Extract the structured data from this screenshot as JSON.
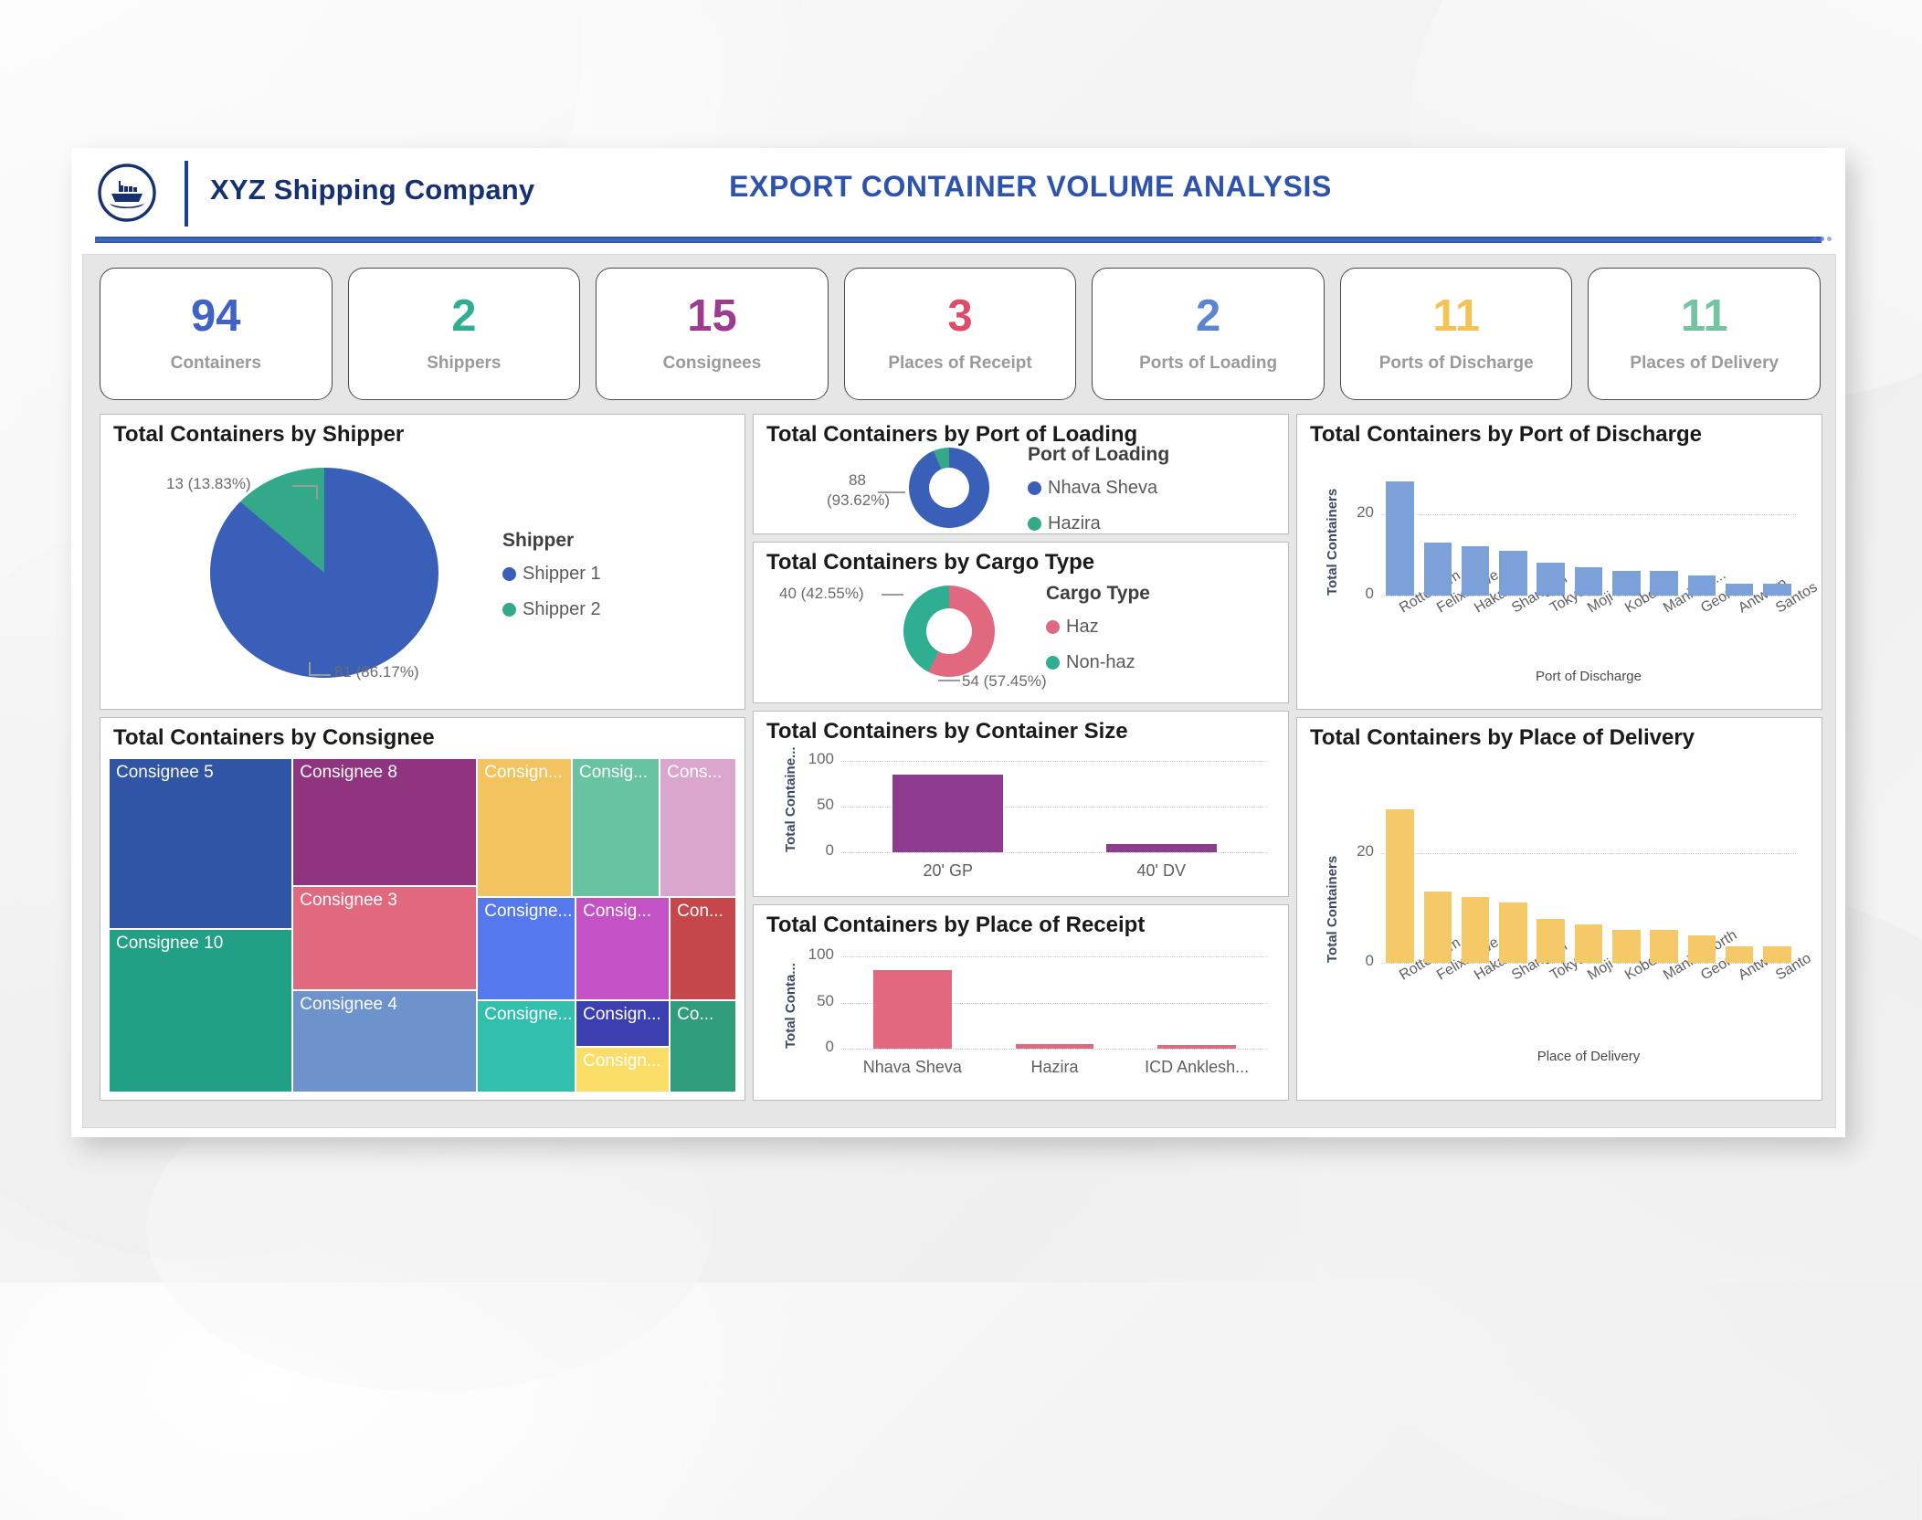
{
  "header": {
    "logo_icon": "ship-icon",
    "company_name": "XYZ Shipping Company",
    "dashboard_title": "EXPORT CONTAINER VOLUME ANALYSIS",
    "brand_color": "#2d53ad"
  },
  "kpis": [
    {
      "value": "94",
      "label": "Containers",
      "color": "#3f62c4"
    },
    {
      "value": "2",
      "label": "Shippers",
      "color": "#2fae92"
    },
    {
      "value": "15",
      "label": "Consignees",
      "color": "#9c3c8f"
    },
    {
      "value": "3",
      "label": "Places of Receipt",
      "color": "#dd4d6a"
    },
    {
      "value": "2",
      "label": "Ports of Loading",
      "color": "#5b86cf"
    },
    {
      "value": "11",
      "label": "Ports of Discharge",
      "color": "#f5c255"
    },
    {
      "value": "11",
      "label": "Places of Delivery",
      "color": "#74c4a2"
    }
  ],
  "panels": {
    "shipper": {
      "title": "Total Containers by Shipper"
    },
    "consignee": {
      "title": "Total Containers by Consignee"
    },
    "pol": {
      "title": "Total Containers by Port of Loading"
    },
    "cargo": {
      "title": "Total Containers by Cargo Type"
    },
    "size": {
      "title": "Total Containers by Container Size"
    },
    "receipt": {
      "title": "Total Containers by Place of Receipt"
    },
    "pod": {
      "title": "Total Containers by Port of Discharge"
    },
    "delivery": {
      "title": "Total Containers by Place of Delivery"
    }
  },
  "chart_data": [
    {
      "id": "shipper_pie",
      "type": "pie",
      "title": "Total Containers by Shipper",
      "legend_title": "Shipper",
      "legend_position": "right",
      "categories": [
        "Shipper 1",
        "Shipper 2"
      ],
      "values": [
        81,
        13
      ],
      "percents": [
        "86.17%",
        "13.83%"
      ],
      "data_labels": [
        "81 (86.17%)",
        "13 (13.83%)"
      ],
      "colors": [
        "#3a5fb8",
        "#34a98a"
      ]
    },
    {
      "id": "consignee_treemap",
      "type": "treemap",
      "title": "Total Containers by Consignee",
      "categories": [
        "Consignee 5",
        "Consignee 10",
        "Consignee 8",
        "Consignee 3",
        "Consignee 4",
        "Consign...",
        "Consig...",
        "Cons...",
        "Consigne...",
        "Consig...",
        "Con...",
        "Consigne...",
        "Consign...",
        "Consign...",
        "Co..."
      ],
      "colors": [
        "#2f55a4",
        "#22a085",
        "#913480",
        "#e0697f",
        "#6e93cc",
        "#f2c35e",
        "#68c3a3",
        "#dba6ce",
        "#5578ef",
        "#c452c6",
        "#c5474a",
        "#33bfae",
        "#3c3fb0",
        "#fade68",
        "#2f9d79"
      ]
    },
    {
      "id": "pol_donut",
      "type": "pie",
      "title": "Total Containers by Port of Loading",
      "legend_title": "Port of Loading",
      "legend_position": "right",
      "categories": [
        "Nhava Sheva",
        "Hazira"
      ],
      "values": [
        88,
        6
      ],
      "percents": [
        "93.62%",
        "6.38%"
      ],
      "data_labels": [
        "88",
        "(93.62%)"
      ],
      "colors": [
        "#3a5fb8",
        "#34a98a"
      ]
    },
    {
      "id": "cargo_donut",
      "type": "pie",
      "title": "Total Containers by Cargo Type",
      "legend_title": "Cargo Type",
      "legend_position": "right",
      "categories": [
        "Haz",
        "Non-haz"
      ],
      "values": [
        54,
        40
      ],
      "percents": [
        "57.45%",
        "42.55%"
      ],
      "data_labels": [
        "54 (57.45%)",
        "40 (42.55%)"
      ],
      "colors": [
        "#e0697f",
        "#2fae92"
      ]
    },
    {
      "id": "container_size_bar",
      "type": "bar",
      "title": "Total Containers by Container Size",
      "ylabel": "Total Containe...",
      "xlabel": "",
      "categories": [
        "20' GP",
        "40' DV"
      ],
      "values": [
        85,
        9
      ],
      "yticks": [
        0,
        50,
        100
      ],
      "ylim": [
        0,
        100
      ],
      "color": "#8c3b8e",
      "grid": true
    },
    {
      "id": "place_of_receipt_bar",
      "type": "bar",
      "title": "Total Containers by Place of Receipt",
      "ylabel": "Total Conta...",
      "xlabel": "",
      "categories": [
        "Nhava Sheva",
        "Hazira",
        "ICD Anklesh..."
      ],
      "values": [
        85,
        5,
        4
      ],
      "yticks": [
        0,
        50,
        100
      ],
      "ylim": [
        0,
        100
      ],
      "color": "#e0697f",
      "grid": true
    },
    {
      "id": "port_of_discharge_bar",
      "type": "bar",
      "title": "Total Containers by Port of Discharge",
      "ylabel": "Total Containers",
      "xlabel": "Port of Discharge",
      "categories": [
        "Rotterdam",
        "Felixstowe",
        "Hakata",
        "Shanghai",
        "Tokyo",
        "Moji",
        "Kobe",
        "Manila N...",
        "Geona",
        "Antwerp",
        "Santos"
      ],
      "values": [
        28,
        13,
        12,
        11,
        8,
        7,
        6,
        6,
        5,
        3,
        3
      ],
      "yticks": [
        0,
        20
      ],
      "ylim": [
        0,
        30
      ],
      "color": "#7ba1d8",
      "grid": true
    },
    {
      "id": "place_of_delivery_bar",
      "type": "bar",
      "title": "Total Containers by Place of Delivery",
      "ylabel": "Total Containers",
      "xlabel": "Place of Delivery",
      "categories": [
        "Rotterdam",
        "Felixstowe",
        "Hakata",
        "Shanghai",
        "Tokyo",
        "Moji",
        "Kobe",
        "Manila North",
        "Geona",
        "Antwerp",
        "Santo"
      ],
      "values": [
        28,
        13,
        12,
        11,
        8,
        7,
        6,
        6,
        5,
        3,
        3
      ],
      "yticks": [
        0,
        20
      ],
      "ylim": [
        0,
        30
      ],
      "color": "#f5c868",
      "grid": true
    }
  ]
}
